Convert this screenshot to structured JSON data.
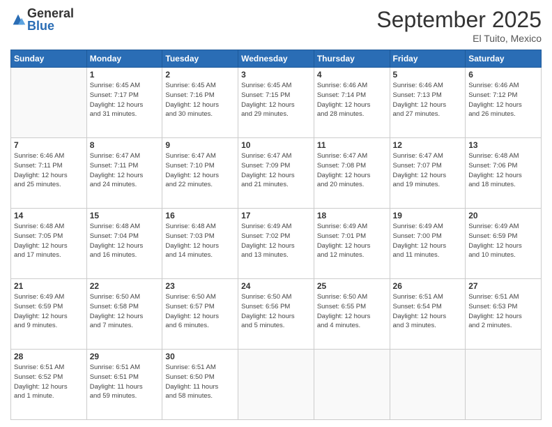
{
  "logo": {
    "general": "General",
    "blue": "Blue"
  },
  "header": {
    "month": "September 2025",
    "location": "El Tuito, Mexico"
  },
  "days": [
    "Sunday",
    "Monday",
    "Tuesday",
    "Wednesday",
    "Thursday",
    "Friday",
    "Saturday"
  ],
  "weeks": [
    [
      {
        "num": "",
        "info": ""
      },
      {
        "num": "1",
        "info": "Sunrise: 6:45 AM\nSunset: 7:17 PM\nDaylight: 12 hours\nand 31 minutes."
      },
      {
        "num": "2",
        "info": "Sunrise: 6:45 AM\nSunset: 7:16 PM\nDaylight: 12 hours\nand 30 minutes."
      },
      {
        "num": "3",
        "info": "Sunrise: 6:45 AM\nSunset: 7:15 PM\nDaylight: 12 hours\nand 29 minutes."
      },
      {
        "num": "4",
        "info": "Sunrise: 6:46 AM\nSunset: 7:14 PM\nDaylight: 12 hours\nand 28 minutes."
      },
      {
        "num": "5",
        "info": "Sunrise: 6:46 AM\nSunset: 7:13 PM\nDaylight: 12 hours\nand 27 minutes."
      },
      {
        "num": "6",
        "info": "Sunrise: 6:46 AM\nSunset: 7:12 PM\nDaylight: 12 hours\nand 26 minutes."
      }
    ],
    [
      {
        "num": "7",
        "info": "Sunrise: 6:46 AM\nSunset: 7:11 PM\nDaylight: 12 hours\nand 25 minutes."
      },
      {
        "num": "8",
        "info": "Sunrise: 6:47 AM\nSunset: 7:11 PM\nDaylight: 12 hours\nand 24 minutes."
      },
      {
        "num": "9",
        "info": "Sunrise: 6:47 AM\nSunset: 7:10 PM\nDaylight: 12 hours\nand 22 minutes."
      },
      {
        "num": "10",
        "info": "Sunrise: 6:47 AM\nSunset: 7:09 PM\nDaylight: 12 hours\nand 21 minutes."
      },
      {
        "num": "11",
        "info": "Sunrise: 6:47 AM\nSunset: 7:08 PM\nDaylight: 12 hours\nand 20 minutes."
      },
      {
        "num": "12",
        "info": "Sunrise: 6:47 AM\nSunset: 7:07 PM\nDaylight: 12 hours\nand 19 minutes."
      },
      {
        "num": "13",
        "info": "Sunrise: 6:48 AM\nSunset: 7:06 PM\nDaylight: 12 hours\nand 18 minutes."
      }
    ],
    [
      {
        "num": "14",
        "info": "Sunrise: 6:48 AM\nSunset: 7:05 PM\nDaylight: 12 hours\nand 17 minutes."
      },
      {
        "num": "15",
        "info": "Sunrise: 6:48 AM\nSunset: 7:04 PM\nDaylight: 12 hours\nand 16 minutes."
      },
      {
        "num": "16",
        "info": "Sunrise: 6:48 AM\nSunset: 7:03 PM\nDaylight: 12 hours\nand 14 minutes."
      },
      {
        "num": "17",
        "info": "Sunrise: 6:49 AM\nSunset: 7:02 PM\nDaylight: 12 hours\nand 13 minutes."
      },
      {
        "num": "18",
        "info": "Sunrise: 6:49 AM\nSunset: 7:01 PM\nDaylight: 12 hours\nand 12 minutes."
      },
      {
        "num": "19",
        "info": "Sunrise: 6:49 AM\nSunset: 7:00 PM\nDaylight: 12 hours\nand 11 minutes."
      },
      {
        "num": "20",
        "info": "Sunrise: 6:49 AM\nSunset: 6:59 PM\nDaylight: 12 hours\nand 10 minutes."
      }
    ],
    [
      {
        "num": "21",
        "info": "Sunrise: 6:49 AM\nSunset: 6:59 PM\nDaylight: 12 hours\nand 9 minutes."
      },
      {
        "num": "22",
        "info": "Sunrise: 6:50 AM\nSunset: 6:58 PM\nDaylight: 12 hours\nand 7 minutes."
      },
      {
        "num": "23",
        "info": "Sunrise: 6:50 AM\nSunset: 6:57 PM\nDaylight: 12 hours\nand 6 minutes."
      },
      {
        "num": "24",
        "info": "Sunrise: 6:50 AM\nSunset: 6:56 PM\nDaylight: 12 hours\nand 5 minutes."
      },
      {
        "num": "25",
        "info": "Sunrise: 6:50 AM\nSunset: 6:55 PM\nDaylight: 12 hours\nand 4 minutes."
      },
      {
        "num": "26",
        "info": "Sunrise: 6:51 AM\nSunset: 6:54 PM\nDaylight: 12 hours\nand 3 minutes."
      },
      {
        "num": "27",
        "info": "Sunrise: 6:51 AM\nSunset: 6:53 PM\nDaylight: 12 hours\nand 2 minutes."
      }
    ],
    [
      {
        "num": "28",
        "info": "Sunrise: 6:51 AM\nSunset: 6:52 PM\nDaylight: 12 hours\nand 1 minute."
      },
      {
        "num": "29",
        "info": "Sunrise: 6:51 AM\nSunset: 6:51 PM\nDaylight: 11 hours\nand 59 minutes."
      },
      {
        "num": "30",
        "info": "Sunrise: 6:51 AM\nSunset: 6:50 PM\nDaylight: 11 hours\nand 58 minutes."
      },
      {
        "num": "",
        "info": ""
      },
      {
        "num": "",
        "info": ""
      },
      {
        "num": "",
        "info": ""
      },
      {
        "num": "",
        "info": ""
      }
    ]
  ]
}
